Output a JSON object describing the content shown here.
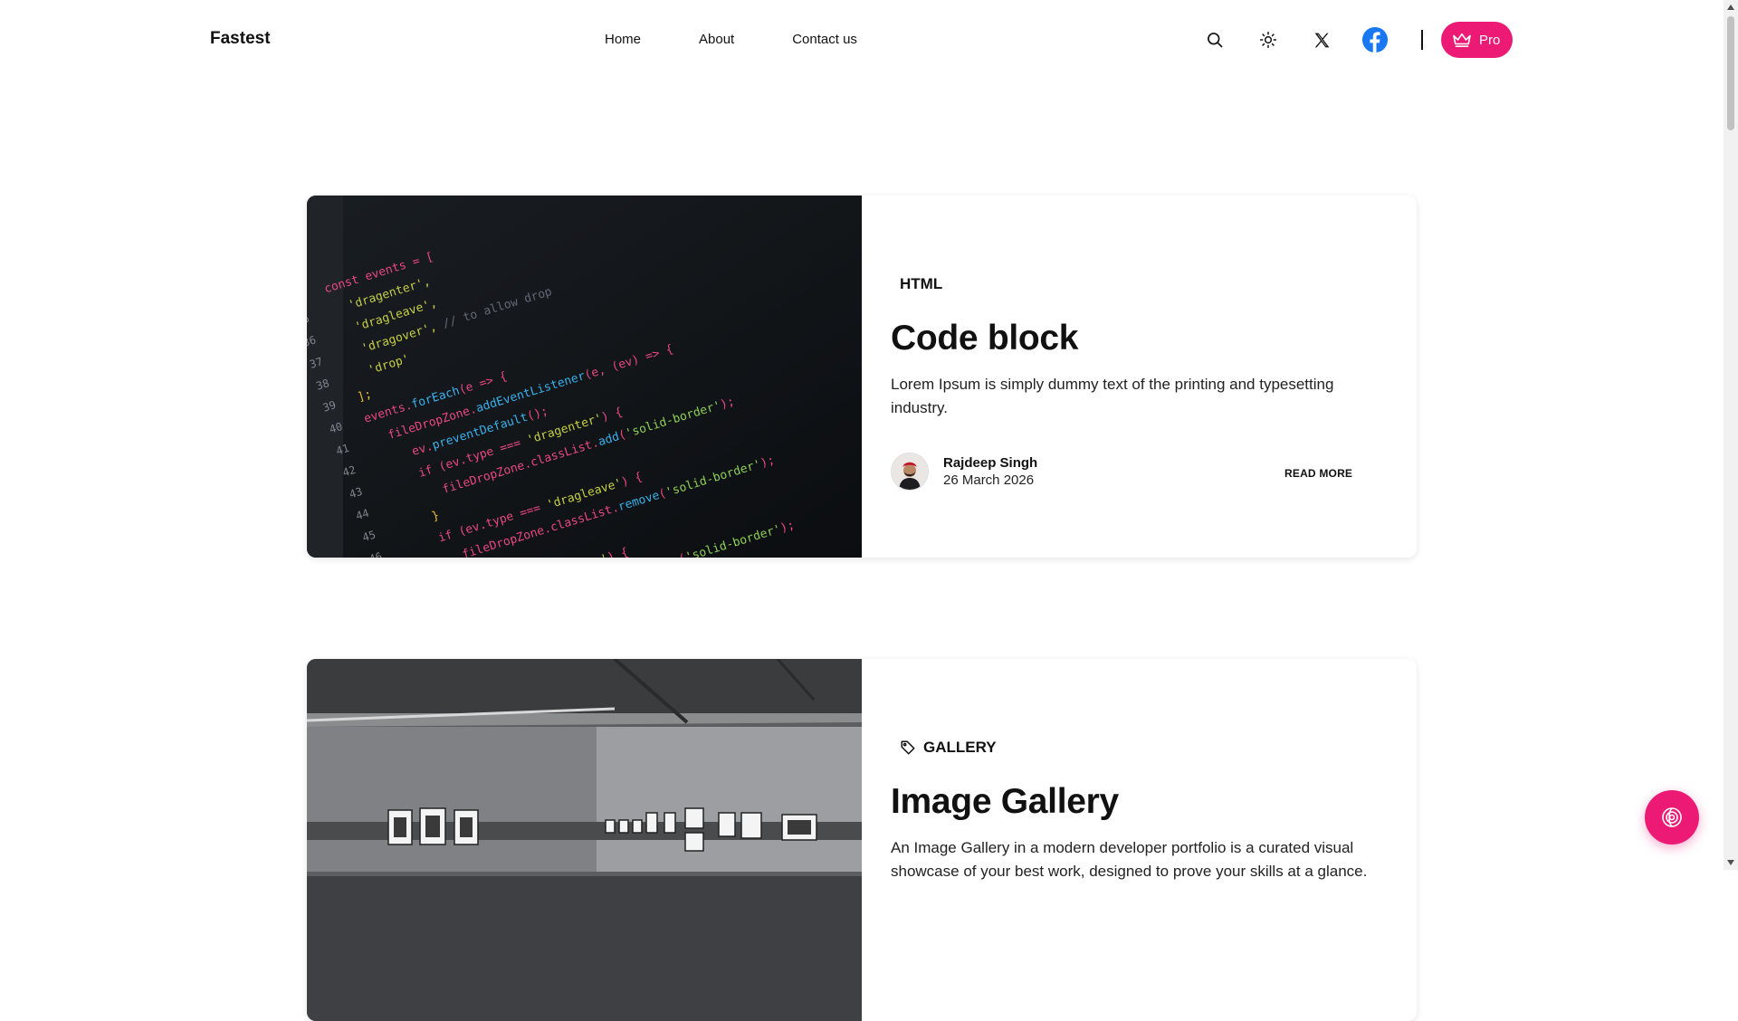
{
  "brand": {
    "name": "Fastest",
    "accent": "#ec1a74"
  },
  "nav": {
    "items": [
      "Home",
      "About",
      "Contact us"
    ]
  },
  "header_actions": {
    "icons": [
      "search-icon",
      "sun-icon",
      "x-twitter-icon",
      "facebook-icon"
    ],
    "pro_label": "Pro"
  },
  "posts": [
    {
      "category": "HTML",
      "title": "Code block",
      "excerpt": "Lorem Ipsum is simply dummy text of the printing and typesetting industry.",
      "author": "Rajdeep Singh",
      "date": "26 March 2026",
      "read_more": "READ MORE"
    },
    {
      "category": "GALLERY",
      "title": "Image Gallery",
      "excerpt": "An Image Gallery in a modern developer portfolio is a curated visual showcase of your best work, designed to prove your skills at a glance."
    }
  ]
}
